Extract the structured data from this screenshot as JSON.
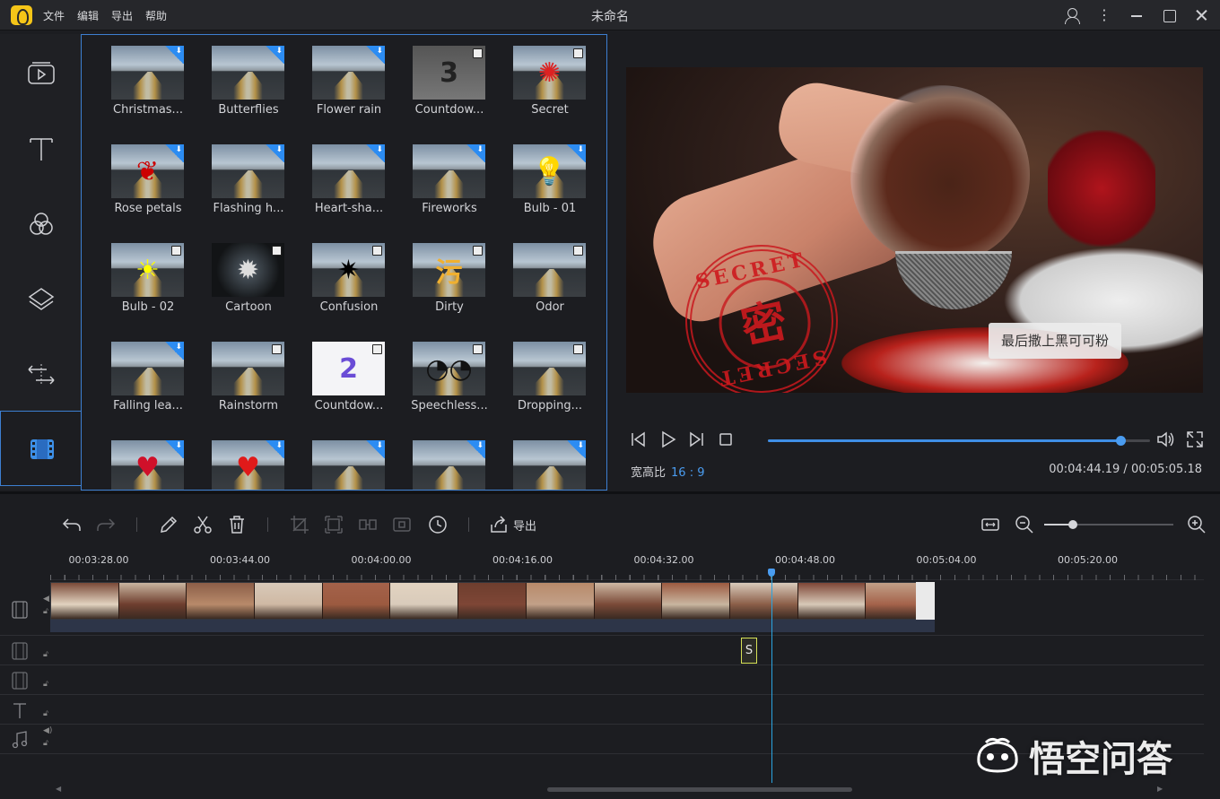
{
  "titlebar": {
    "title": "未命名",
    "menu": [
      "文件",
      "编辑",
      "导出",
      "帮助"
    ]
  },
  "sidebar": {
    "items": [
      {
        "name": "media",
        "icon": "media-icon"
      },
      {
        "name": "text",
        "icon": "text-icon"
      },
      {
        "name": "filters",
        "icon": "filters-icon"
      },
      {
        "name": "overlays",
        "icon": "overlays-icon"
      },
      {
        "name": "transitions",
        "icon": "transitions-icon"
      },
      {
        "name": "elements",
        "icon": "film-icon",
        "active": true
      }
    ]
  },
  "library": {
    "tiles": [
      {
        "label": "Christmas...",
        "badge": "download"
      },
      {
        "label": "Butterflies",
        "badge": "download"
      },
      {
        "label": "Flower rain",
        "badge": "download"
      },
      {
        "label": "Countdow...",
        "badge": "effect"
      },
      {
        "label": "Secret",
        "badge": "effect"
      },
      {
        "label": "Rose petals",
        "badge": "download"
      },
      {
        "label": "Flashing h...",
        "badge": "download"
      },
      {
        "label": "Heart-sha...",
        "badge": "download"
      },
      {
        "label": "Fireworks",
        "badge": "download"
      },
      {
        "label": "Bulb - 01",
        "badge": "download"
      },
      {
        "label": "Bulb - 02",
        "badge": "effect"
      },
      {
        "label": "Cartoon",
        "badge": "effect"
      },
      {
        "label": "Confusion",
        "badge": "effect"
      },
      {
        "label": "Dirty",
        "badge": "effect"
      },
      {
        "label": "Odor",
        "badge": "effect"
      },
      {
        "label": "Falling lea...",
        "badge": "download"
      },
      {
        "label": "Rainstorm",
        "badge": "effect"
      },
      {
        "label": "Countdow...",
        "badge": "effect"
      },
      {
        "label": "Speechless...",
        "badge": "effect"
      },
      {
        "label": "Dropping...",
        "badge": "effect"
      },
      {
        "label": "",
        "badge": "download"
      },
      {
        "label": "",
        "badge": "download"
      },
      {
        "label": "",
        "badge": "download"
      },
      {
        "label": "",
        "badge": "download"
      },
      {
        "label": "",
        "badge": "download"
      }
    ]
  },
  "preview": {
    "stamp_char": "密",
    "stamp_top": "SECRET",
    "stamp_bottom": "SECRET",
    "caption": "最后撒上黑可可粉",
    "progress": 0.922,
    "aspect_label": "宽高比",
    "aspect_value": "16 : 9",
    "current_time": "00:04:44.19",
    "total_time": "00:05:05.18",
    "time_sep": " / "
  },
  "timeline": {
    "export_label": "导出",
    "zoom": 0.22,
    "ruler": [
      "00:03:28.00",
      "00:03:44.00",
      "00:04:00.00",
      "00:04:16.00",
      "00:04:32.00",
      "00:04:48.00",
      "00:05:04.00",
      "00:05:20.00"
    ],
    "playhead_time": "00:04:44.19",
    "fx_clip_label": "S"
  },
  "watermark": {
    "text": "悟空问答"
  },
  "colors": {
    "accent": "#3d7fd1",
    "progress": "#3f8fe6",
    "playhead": "#2aa4e0",
    "stamp": "#c8191e"
  }
}
